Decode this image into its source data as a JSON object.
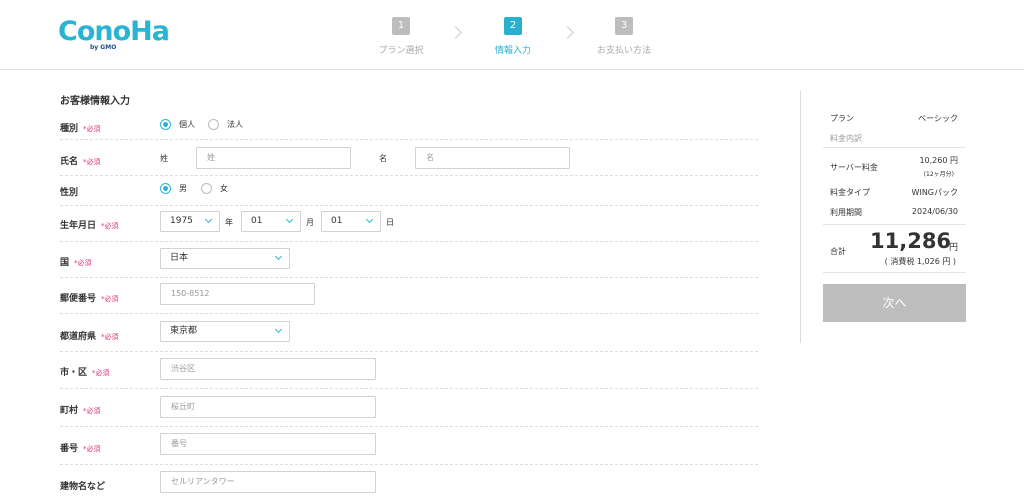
{
  "header": {
    "logo_text": "ConoHa",
    "logo_sub": "by GMO",
    "steps": [
      {
        "num": "1",
        "label": "プラン選択"
      },
      {
        "num": "2",
        "label": "情報入力"
      },
      {
        "num": "3",
        "label": "お支払い方法"
      }
    ]
  },
  "form": {
    "title": "お客様情報入力",
    "required": "*必須",
    "type": {
      "label": "種別",
      "options": [
        "個人",
        "法人"
      ],
      "selected": "個人"
    },
    "name": {
      "label": "氏名",
      "sei_label": "姓",
      "sei_placeholder": "姓",
      "mei_label": "名",
      "mei_placeholder": "名"
    },
    "gender": {
      "label": "性別",
      "options": [
        "男",
        "女"
      ],
      "selected": "男"
    },
    "birthday": {
      "label": "生年月日",
      "year": "1975",
      "year_unit": "年",
      "month": "01",
      "month_unit": "月",
      "day": "01",
      "day_unit": "日"
    },
    "country": {
      "label": "国",
      "value": "日本"
    },
    "zip": {
      "label": "郵便番号",
      "placeholder": "150-8512"
    },
    "prefecture": {
      "label": "都道府県",
      "value": "東京都"
    },
    "city": {
      "label": "市・区",
      "placeholder": "渋谷区"
    },
    "town": {
      "label": "町村",
      "placeholder": "桜丘町"
    },
    "number": {
      "label": "番号",
      "placeholder": "番号"
    },
    "building": {
      "label": "建物名など",
      "placeholder": "セルリアンタワー"
    }
  },
  "summary": {
    "plan_label": "プラン",
    "plan_value": "ベーシック",
    "breakdown_label": "料金内訳",
    "server_label": "サーバー料金",
    "server_value": "10,260 円",
    "server_note": "(12ヶ月分)",
    "fee_type_label": "料金タイプ",
    "fee_type_value": "WINGパック",
    "period_label": "利用期間",
    "period_value": "2024/06/30",
    "total_label": "合計",
    "total_value": "11,286",
    "total_unit": "円",
    "tax_note": "( 消費税 1,026 円 )",
    "next_button": "次へ"
  },
  "colors": {
    "accent": "#28b1ce",
    "required": "#e0307a",
    "button_disabled": "#bdbdbd"
  }
}
